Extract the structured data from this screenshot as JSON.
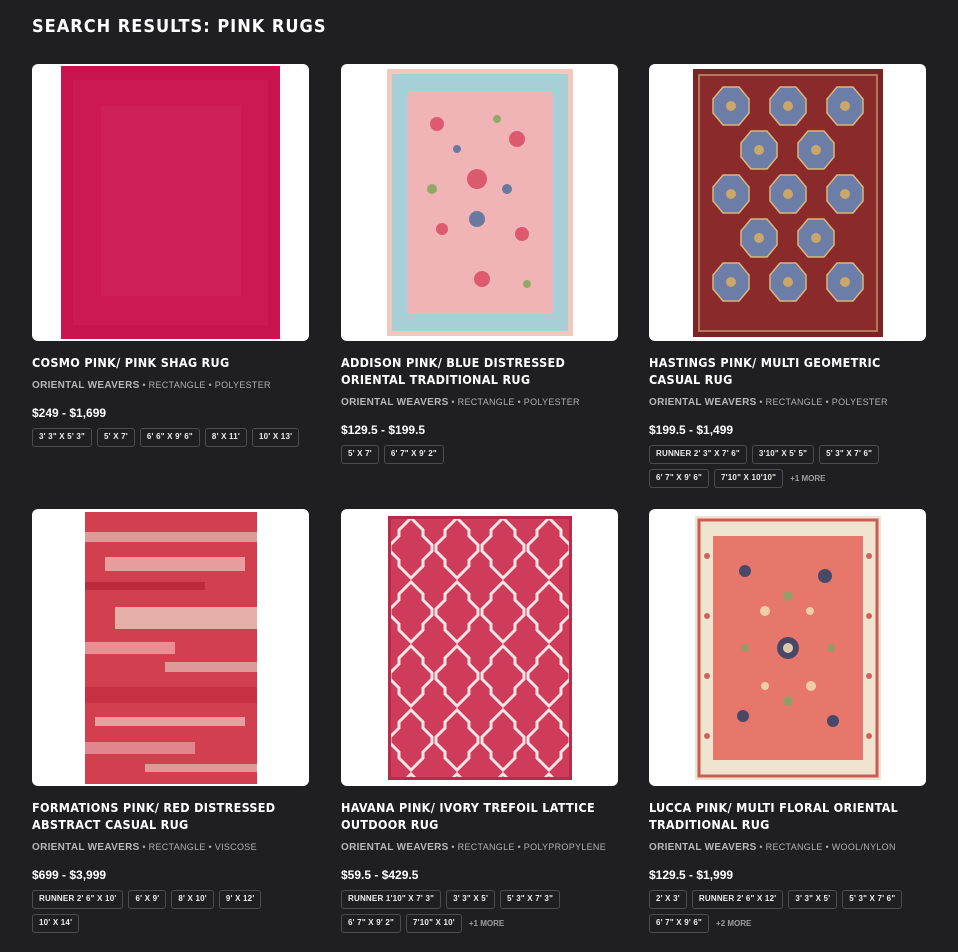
{
  "page": {
    "title": "SEARCH RESULTS: PINK RUGS"
  },
  "products": [
    {
      "name": "COSMO PINK/ PINK SHAG RUG",
      "brand": "ORIENTAL WEAVERS",
      "shape": "RECTANGLE",
      "material": "POLYESTER",
      "price": "$249 - $1,699",
      "sizes": [
        "3' 3\" X 5' 3\"",
        "5' X 7'",
        "6' 6\" X 9' 6\"",
        "8' X 11'",
        "10' X 13'"
      ],
      "more": "",
      "image_icon": "shag-rug-image",
      "colors": {
        "main": "#c8134e",
        "accent": "#d82a63"
      }
    },
    {
      "name": "ADDISON PINK/ BLUE DISTRESSED ORIENTAL TRADITIONAL RUG",
      "brand": "ORIENTAL WEAVERS",
      "shape": "RECTANGLE",
      "material": "POLYESTER",
      "price": "$129.5 - $199.5",
      "sizes": [
        "5' X 7'",
        "6' 7\" X 9' 2\""
      ],
      "more": "",
      "image_icon": "oriental-rug-image",
      "colors": {
        "main": "#f0b4b6",
        "border": "#a6cfd8"
      }
    },
    {
      "name": "HASTINGS PINK/ MULTI GEOMETRIC CASUAL RUG",
      "brand": "ORIENTAL WEAVERS",
      "shape": "RECTANGLE",
      "material": "POLYESTER",
      "price": "$199.5 - $1,499",
      "sizes": [
        "RUNNER 2' 3\" X 7' 6\"",
        "3'10\" X 5' 5\"",
        "5' 3\" X 7' 6\"",
        "6' 7\" X 9' 6\"",
        "7'10\" X 10'10\""
      ],
      "more": "+1 MORE",
      "image_icon": "geometric-rug-image",
      "colors": {
        "main": "#8a2a2a",
        "accent": "#6c7da8"
      }
    },
    {
      "name": "FORMATIONS PINK/ RED DISTRESSED ABSTRACT CASUAL RUG",
      "brand": "ORIENTAL WEAVERS",
      "shape": "RECTANGLE",
      "material": "VISCOSE",
      "price": "$699 - $3,999",
      "sizes": [
        "RUNNER 2' 6\" X 10'",
        "6' X 9'",
        "8' X 10'",
        "9' X 12'",
        "10' X 14'"
      ],
      "more": "",
      "image_icon": "abstract-rug-image",
      "colors": {
        "main": "#d23f4e",
        "accent": "#e8d6c6"
      }
    },
    {
      "name": "HAVANA PINK/ IVORY TREFOIL LATTICE OUTDOOR RUG",
      "brand": "ORIENTAL WEAVERS",
      "shape": "RECTANGLE",
      "material": "POLYPROPYLENE",
      "price": "$59.5 - $429.5",
      "sizes": [
        "RUNNER 1'10\" X 7' 3\"",
        "3' 3\" X 5'",
        "5' 3\" X 7' 3\"",
        "6' 7\" X 9' 2\"",
        "7'10\" X 10'"
      ],
      "more": "+1 MORE",
      "image_icon": "lattice-rug-image",
      "colors": {
        "main": "#cf3b5a",
        "accent": "#f6e6e3"
      }
    },
    {
      "name": "LUCCA PINK/ MULTI FLORAL ORIENTAL TRADITIONAL RUG",
      "brand": "ORIENTAL WEAVERS",
      "shape": "RECTANGLE",
      "material": "WOOL/NYLON",
      "price": "$129.5 - $1,999",
      "sizes": [
        "2' X 3'",
        "RUNNER 2' 6\" X 12'",
        "3' 3\" X 5'",
        "5' 3\" X 7' 6\"",
        "6' 7\" X 9' 6\""
      ],
      "more": "+2 MORE",
      "image_icon": "floral-rug-image",
      "colors": {
        "main": "#e8776b",
        "border": "#efe4cf"
      }
    }
  ]
}
